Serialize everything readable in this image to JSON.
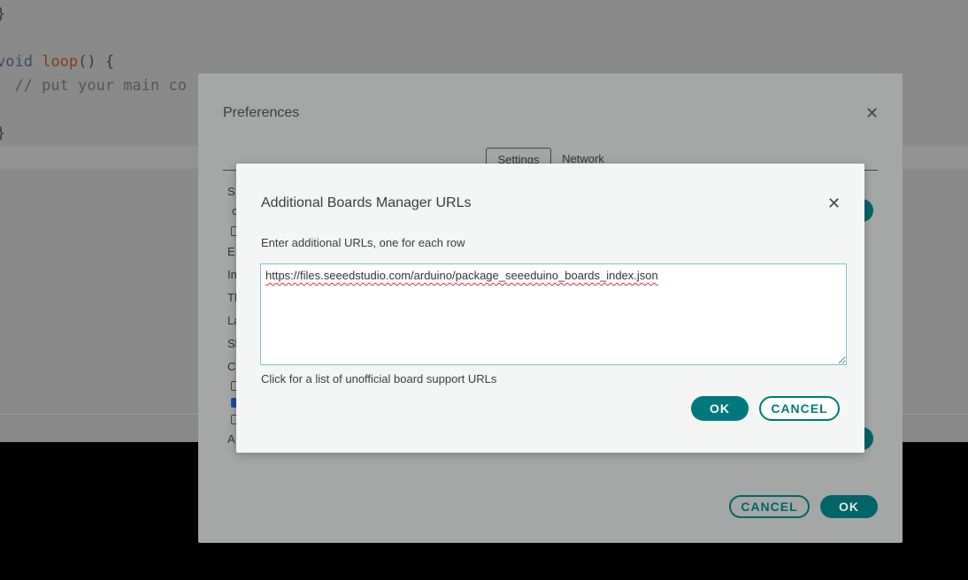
{
  "editor": {
    "line1": "}",
    "line2_kw": "void",
    "line2_fn": "loop",
    "line2_rest": "() {",
    "line3": "  // put your main co",
    "line4": "}"
  },
  "preferences": {
    "title": "Preferences",
    "tabs": [
      {
        "label": "Settings"
      },
      {
        "label": "Network"
      }
    ],
    "fragments": [
      "S",
      "c",
      "E",
      "In",
      "Th",
      "La",
      "Sh",
      "C",
      "A"
    ],
    "cancel_label": "CANCEL",
    "ok_label": "OK"
  },
  "dialog": {
    "title": "Additional Boards Manager URLs",
    "instruction": "Enter additional URLs, one for each row",
    "urls_value": "https://files.seeedstudio.com/arduino/package_seeeduino_boards_index.json",
    "link_text": "Click for a list of unofficial board support URLs",
    "ok_label": "OK",
    "cancel_label": "CANCEL"
  },
  "colors": {
    "accent": "#00797c",
    "overlay_accent": "#006468"
  }
}
